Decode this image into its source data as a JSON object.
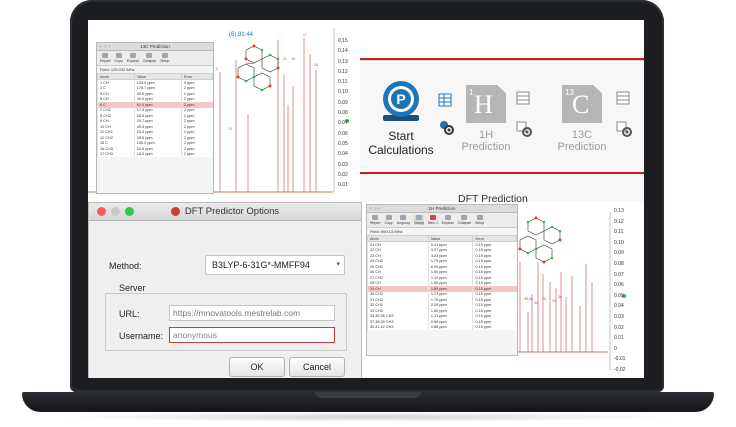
{
  "ribbon": {
    "start_label": "Start Calculations",
    "h1_label": "1H Prediction",
    "c13_label": "13C Prediction",
    "group_label": "DFT Prediction",
    "h_icon_text": "H",
    "h_icon_sup": "1",
    "c_icon_text": "C",
    "c_icon_sup": "13",
    "accent": "#c61c1c",
    "brand_blue": "#1f73b7"
  },
  "dialog": {
    "title": "DFT Predictor Options",
    "method_label": "Method:",
    "method_value": "B3LYP-6-31G*-MMFF94",
    "server_label": "Server",
    "url_label": "URL:",
    "url_placeholder": "https://mnovatools.mestrelab.com",
    "username_label": "Username:",
    "username_placeholder": "anonymous",
    "ok_label": "OK",
    "cancel_label": "Cancel"
  },
  "c13_window": {
    "title": "13C Prediction",
    "toolbar": [
      "Report",
      "Copy",
      "Expand",
      "Collapse",
      "Setup"
    ],
    "field": "Field: 125.032 MHz",
    "columns": [
      "Atom",
      "Value",
      "Error"
    ],
    "rows": [
      [
        "1 CH",
        "103.9 ppm",
        "2 ppm"
      ],
      [
        "2 C",
        "176.7 ppm",
        "2 ppm"
      ],
      [
        "3 CH",
        "34.6 ppm",
        "2 ppm"
      ],
      [
        "5 CH",
        "40.0 ppm",
        "2 ppm"
      ],
      [
        "6 C",
        "61.4 ppm",
        "2 ppm"
      ],
      [
        "7 CH2",
        "17.3 ppm",
        "2 ppm"
      ],
      [
        "8 CH2",
        "28.5 ppm",
        "2 ppm"
      ],
      [
        "9 CH",
        "29.7 ppm",
        "2 ppm"
      ],
      [
        "10 CH",
        "49.5 ppm",
        "2 ppm"
      ],
      [
        "11 CH2",
        "20.3 ppm",
        "2 ppm"
      ],
      [
        "12 CH2",
        "28.5 ppm",
        "2 ppm"
      ],
      [
        "15 C",
        "100.0 ppm",
        "2 ppm"
      ],
      [
        "16 CH3",
        "24.9 ppm",
        "2 ppm"
      ],
      [
        "17 CH3",
        "18.0 ppm",
        "2 ppm"
      ]
    ],
    "selected_row": 4
  },
  "h1_window": {
    "title": "1H Prediction",
    "toolbar": [
      "Report",
      "Copy",
      "Ungroup",
      "Group",
      "New J",
      "Expand",
      "Collapse",
      "Setup"
    ],
    "field": "Field: 500.13 MHz",
    "columns": [
      "Atom",
      "Value",
      "Error"
    ],
    "rows": [
      [
        "21 CH",
        "5.41 ppm",
        "0.15 ppm"
      ],
      [
        "22 CH",
        "3.07 ppm",
        "0.15 ppm"
      ],
      [
        "23 CH",
        "3.23 ppm",
        "0.15 ppm"
      ],
      [
        "24 CH2",
        "1.79 ppm",
        "0.15 ppm"
      ],
      [
        "25 CH2",
        "6.04 ppm",
        "0.15 ppm"
      ],
      [
        "26 CH",
        "1.60 ppm",
        "0.15 ppm"
      ],
      [
        "27 CH2",
        "1.10 ppm",
        "0.15 ppm"
      ],
      [
        "28 CH",
        "1.55 ppm",
        "0.15 ppm"
      ],
      [
        "29 CH",
        "1.80 ppm",
        "0.15 ppm"
      ],
      [
        "30 CH2",
        "1.73 ppm",
        "0.15 ppm"
      ],
      [
        "31 CH2",
        "1.75 ppm",
        "0.15 ppm"
      ],
      [
        "32 CH2",
        "2.28 ppm",
        "0.15 ppm"
      ],
      [
        "33 CH2",
        "1.50 ppm",
        "0.15 ppm"
      ],
      [
        "34,35,36 CH3",
        "1.31 ppm",
        "0.15 ppm"
      ],
      [
        "37,38,39 CH3",
        "0.96 ppm",
        "0.15 ppm"
      ],
      [
        "40,41,42 CH3",
        "0.88 ppm",
        "0.15 ppm"
      ]
    ],
    "selected_row": 8
  },
  "spectrum_top": {
    "peak_label": "(6),81.44",
    "ticks": [
      "0.15",
      "0.14",
      "0.13",
      "0.12",
      "0.11",
      "0.10",
      "0.09",
      "0.08",
      "0.07",
      "0.06",
      "0.05",
      "0.04",
      "0.03",
      "0.02",
      "0.01",
      "0"
    ]
  },
  "spectrum_bottom": {
    "ticks": [
      "0.13",
      "0.12",
      "0.11",
      "0.10",
      "0.09",
      "0.08",
      "0.07",
      "0.06",
      "0.05",
      "0.04",
      "0.03",
      "0.02",
      "0.01",
      "0",
      "-0.01",
      "-0.02"
    ]
  }
}
